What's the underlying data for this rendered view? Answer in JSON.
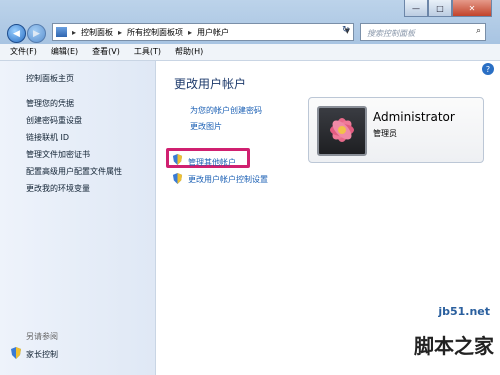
{
  "window": {
    "minimize": "—",
    "maximize": "□",
    "close": "✕"
  },
  "address": {
    "crumbs": [
      "控制面板",
      "所有控制面板项",
      "用户帐户"
    ],
    "sep": "▸"
  },
  "search": {
    "placeholder": "搜索控制面板"
  },
  "menu": [
    "文件(F)",
    "编辑(E)",
    "查看(V)",
    "工具(T)",
    "帮助(H)"
  ],
  "sidebar": {
    "home": "控制面板主页",
    "items": [
      "管理您的凭据",
      "创建密码重设盘",
      "链接联机 ID",
      "管理文件加密证书",
      "配置高级用户配置文件属性",
      "更改我的环境变量"
    ],
    "see_also": "另请参阅",
    "parental": "家长控制"
  },
  "main": {
    "heading": "更改用户帐户",
    "links": [
      "为您的帐户创建密码",
      "更改图片"
    ],
    "manage_other": "管理其他帐户",
    "uac": "更改用户帐户控制设置"
  },
  "user": {
    "name": "Administrator",
    "role": "管理员"
  },
  "help": "?",
  "watermark": {
    "site": "jb51.net",
    "brand": "脚本之家"
  }
}
